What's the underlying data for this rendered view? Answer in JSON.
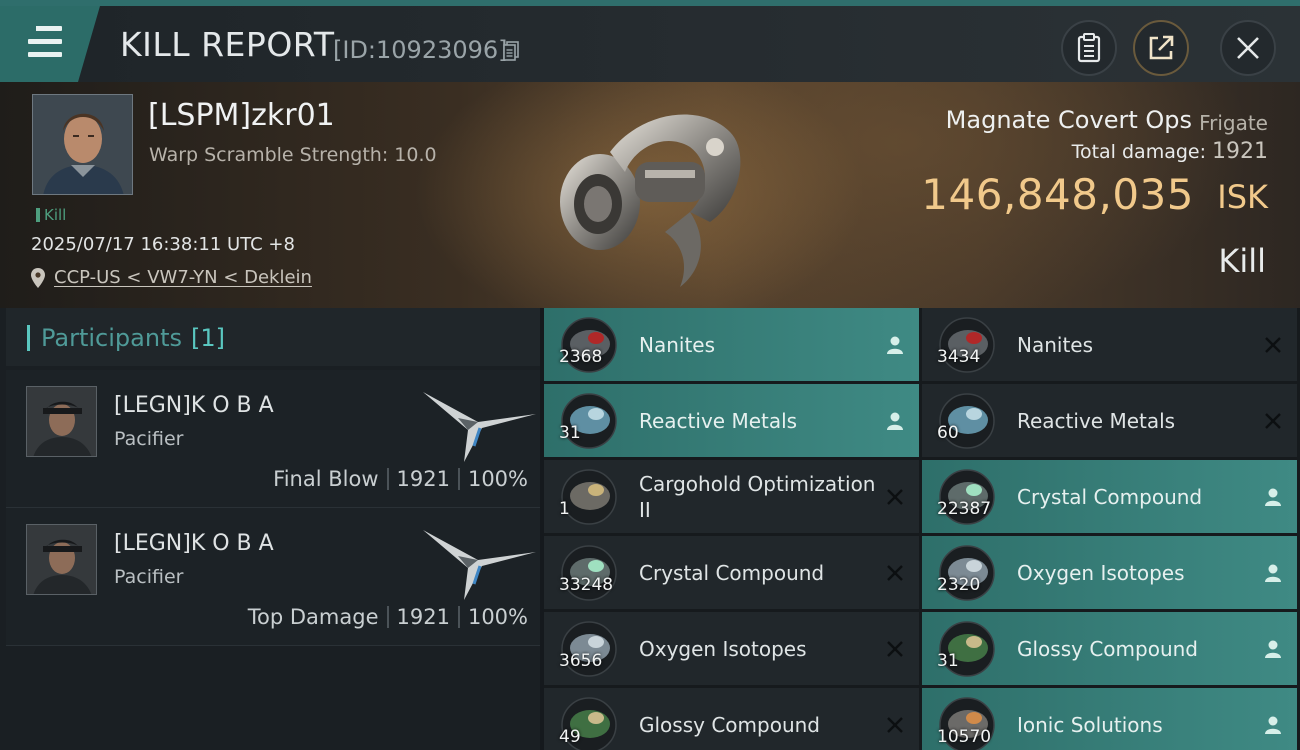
{
  "header": {
    "title": "KILL REPORT",
    "report_id": "[ID:10923096]",
    "icons": [
      "menu-icon",
      "copy-icon",
      "clipboard-icon",
      "share-icon",
      "close-icon"
    ]
  },
  "victim": {
    "name": "[LSPM]zkr01",
    "warp_scramble": "Warp Scramble Strength: 10.0",
    "kill_tag": "Kill",
    "datetime": "2025/07/17 16:38:11 UTC +8",
    "location": "CCP-US < VW7-YN < Deklein",
    "ship_name": "Magnate Covert Ops",
    "ship_class": "Frigate",
    "total_damage_label": "Total damage:",
    "total_damage": "1921",
    "isk_value": "146,848,035",
    "isk_unit": "ISK",
    "result": "Kill"
  },
  "participants": {
    "label": "Participants",
    "count": "[1]",
    "rows": [
      {
        "name": "[LEGN]K O B A",
        "ship": "Pacifier",
        "role": "Final Blow",
        "damage": "1921",
        "percent": "100%"
      },
      {
        "name": "[LEGN]K O B A",
        "ship": "Pacifier",
        "role": "Top Damage",
        "damage": "1921",
        "percent": "100%"
      }
    ]
  },
  "items": {
    "left": [
      {
        "name": "Nanites",
        "qty": "2368",
        "status": "dropped",
        "status_icon": "person-icon",
        "thumb_icon": "nanites-icon"
      },
      {
        "name": "Reactive Metals",
        "qty": "31",
        "status": "dropped",
        "status_icon": "person-icon",
        "thumb_icon": "reactive-metals-icon"
      },
      {
        "name": "Cargohold Optimization II",
        "qty": "1",
        "status": "destroyed",
        "status_icon": "x-icon",
        "thumb_icon": "cargohold-module-icon"
      },
      {
        "name": "Crystal Compound",
        "qty": "33248",
        "status": "destroyed",
        "status_icon": "x-icon",
        "thumb_icon": "crystal-compound-icon"
      },
      {
        "name": "Oxygen Isotopes",
        "qty": "3656",
        "status": "destroyed",
        "status_icon": "x-icon",
        "thumb_icon": "oxygen-isotopes-icon"
      },
      {
        "name": "Glossy Compound",
        "qty": "49",
        "status": "destroyed",
        "status_icon": "x-icon",
        "thumb_icon": "glossy-compound-icon"
      }
    ],
    "right": [
      {
        "name": "Nanites",
        "qty": "3434",
        "status": "destroyed",
        "status_icon": "x-icon",
        "thumb_icon": "nanites-icon"
      },
      {
        "name": "Reactive Metals",
        "qty": "60",
        "status": "destroyed",
        "status_icon": "x-icon",
        "thumb_icon": "reactive-metals-icon"
      },
      {
        "name": "Crystal Compound",
        "qty": "22387",
        "status": "dropped",
        "status_icon": "person-icon",
        "thumb_icon": "crystal-compound-icon"
      },
      {
        "name": "Oxygen Isotopes",
        "qty": "2320",
        "status": "dropped",
        "status_icon": "person-icon",
        "thumb_icon": "oxygen-isotopes-icon"
      },
      {
        "name": "Glossy Compound",
        "qty": "31",
        "status": "dropped",
        "status_icon": "person-icon",
        "thumb_icon": "glossy-compound-icon"
      },
      {
        "name": "Ionic Solutions",
        "qty": "10570",
        "status": "dropped",
        "status_icon": "person-icon",
        "thumb_icon": "ionic-solutions-icon"
      }
    ]
  },
  "colors": {
    "accent_teal": "#3f8a84",
    "isk_gold": "#f1c98b",
    "kill_green": "#4e9e7e"
  }
}
